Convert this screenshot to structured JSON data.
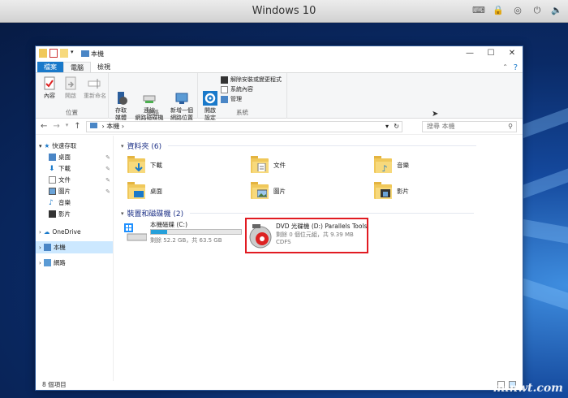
{
  "host": {
    "title": "Windows 10",
    "icons": [
      "keyboard-icon",
      "lock-icon",
      "disc-icon",
      "power-icon",
      "speaker-icon"
    ]
  },
  "window": {
    "title": "本機",
    "tabs": [
      {
        "label": "檔案"
      },
      {
        "label": "電腦"
      },
      {
        "label": "檢視"
      }
    ],
    "ribbon": {
      "groups": [
        {
          "label": "位置",
          "buttons": [
            "內容",
            "開啟",
            "重新命名"
          ]
        },
        {
          "label": "網路",
          "buttons": [
            "存取\n媒體",
            "連線\n網路磁碟機",
            "新增一個\n網路位置"
          ]
        },
        {
          "label": "系統",
          "buttons": [
            "開啟\n設定"
          ],
          "small": [
            "解除安裝或變更程式",
            "系統內容",
            "管理"
          ]
        }
      ]
    },
    "address": {
      "path": "本機",
      "search_placeholder": "搜尋 本機"
    },
    "sidebar": {
      "items": [
        {
          "label": "快速存取",
          "level": 0
        },
        {
          "label": "桌面",
          "level": 1,
          "pinned": true
        },
        {
          "label": "下載",
          "level": 1,
          "pinned": true
        },
        {
          "label": "文件",
          "level": 1,
          "pinned": true
        },
        {
          "label": "圖片",
          "level": 1,
          "pinned": true
        },
        {
          "label": "音樂",
          "level": 1
        },
        {
          "label": "影片",
          "level": 1
        },
        {
          "label": "OneDrive",
          "level": 0
        },
        {
          "label": "本機",
          "level": 0,
          "selected": true
        },
        {
          "label": "網路",
          "level": 0
        }
      ]
    },
    "folders_header": "資料夾 (6)",
    "folders": [
      {
        "label": "下載",
        "icon": "download-arrow"
      },
      {
        "label": "文件",
        "icon": "document"
      },
      {
        "label": "音樂",
        "icon": "music-note"
      },
      {
        "label": "桌面",
        "icon": "desktop"
      },
      {
        "label": "圖片",
        "icon": "picture"
      },
      {
        "label": "影片",
        "icon": "film"
      }
    ],
    "drives_header": "裝置和磁碟機 (2)",
    "drives": [
      {
        "name": "本機磁碟 (C:)",
        "detail": "剩餘 52.2 GB，共 63.5 GB",
        "used_fraction": 0.18
      },
      {
        "name": "DVD 光碟機 (D:) Parallels Tools",
        "detail": "剩餘 0 個位元組，共 9.39 MB",
        "fs": "CDFS",
        "highlight_color": "#e11b22"
      }
    ],
    "status": "8 個項目"
  },
  "watermark": "minwt.com",
  "colors": {
    "accent": "#1979ca",
    "highlight": "#e11b22",
    "selection": "#cce8ff"
  }
}
